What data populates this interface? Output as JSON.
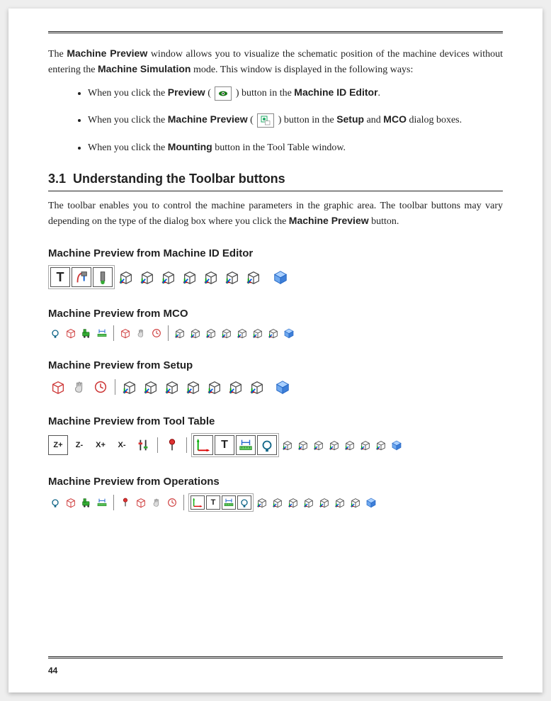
{
  "page_number": "44",
  "intro": {
    "pre1": "The ",
    "b1": "Machine Preview",
    "mid1": " window allows you to visualize the schematic position of the machine devices without entering the ",
    "b2": "Machine Simulation",
    "mid2": " mode. This window is displayed in the following ways:"
  },
  "bullets": {
    "b1_a": "When you click the ",
    "b1_b": "Preview",
    "b1_c": " ( ",
    "b1_d": " ) button in the ",
    "b1_e": "Machine ID Editor",
    "b1_f": ".",
    "b2_a": "When you click the ",
    "b2_b": "Machine Preview",
    "b2_c": " ( ",
    "b2_d": " ) button in the ",
    "b2_e": "Setup",
    "b2_f": " and ",
    "b2_g": "MCO",
    "b2_h": " dialog boxes.",
    "b3_a": "When you click the ",
    "b3_b": "Mounting",
    "b3_c": " button in the Tool Table window."
  },
  "section": {
    "num": "3.1",
    "title": "Understanding the Toolbar buttons",
    "desc_a": "The toolbar enables you to control the machine parameters in the graphic area. The toolbar buttons may vary depending on the type of the dialog box where you click the ",
    "desc_b": "Machine Preview",
    "desc_c": " button."
  },
  "sub1": "Machine Preview from Machine ID Editor",
  "sub2": "Machine Preview from MCO",
  "sub3": "Machine Preview from Setup",
  "sub4": "Machine Preview from Tool Table",
  "sub5": "Machine Preview from Operations",
  "txtbtn": {
    "T": "T",
    "Zp": "Z+",
    "Zm": "Z-",
    "Xp": "X+",
    "Xm": "X-"
  }
}
